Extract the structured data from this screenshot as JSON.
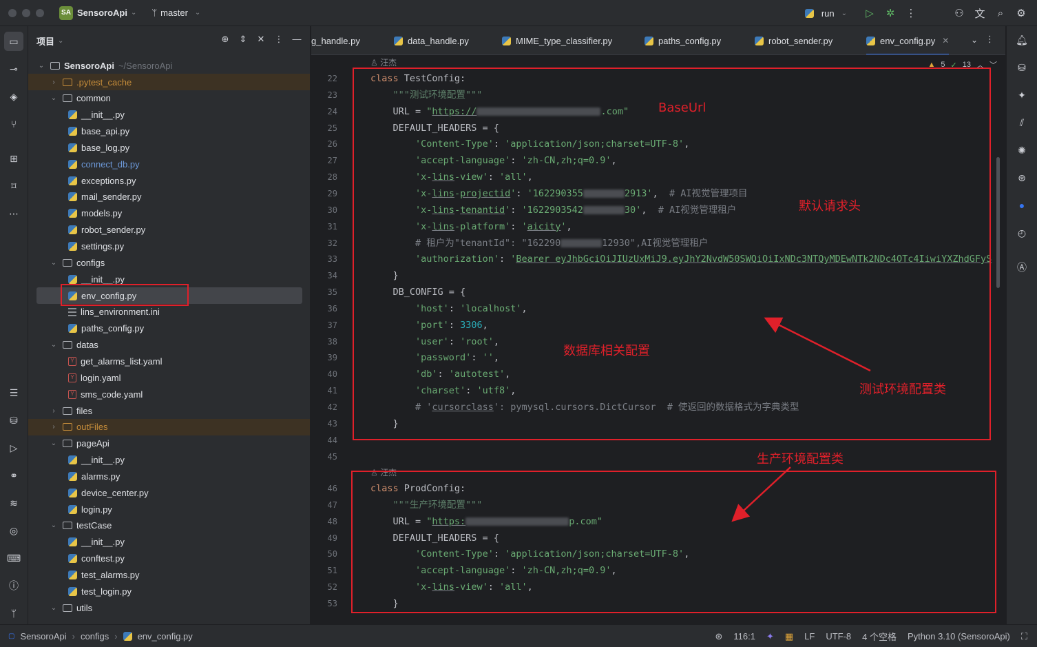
{
  "titlebar": {
    "project_badge": "SA",
    "project_name": "SensoroApi",
    "branch": "master",
    "run_config": "run"
  },
  "project_panel": {
    "title": "项目",
    "root_name": "SensoroApi",
    "root_path": "~/SensoroApi",
    "items": [
      {
        "label": ".pytest_cache",
        "kind": "folder",
        "depth": 1,
        "expanded": false,
        "excluded": true
      },
      {
        "label": "common",
        "kind": "folder",
        "depth": 1,
        "expanded": true
      },
      {
        "label": "__init__.py",
        "kind": "py",
        "depth": 2
      },
      {
        "label": "base_api.py",
        "kind": "py",
        "depth": 2
      },
      {
        "label": "base_log.py",
        "kind": "py",
        "depth": 2
      },
      {
        "label": "connect_db.py",
        "kind": "py",
        "depth": 2,
        "link": true
      },
      {
        "label": "exceptions.py",
        "kind": "py",
        "depth": 2
      },
      {
        "label": "mail_sender.py",
        "kind": "py",
        "depth": 2
      },
      {
        "label": "models.py",
        "kind": "py",
        "depth": 2
      },
      {
        "label": "robot_sender.py",
        "kind": "py",
        "depth": 2
      },
      {
        "label": "settings.py",
        "kind": "py",
        "depth": 2
      },
      {
        "label": "configs",
        "kind": "folder",
        "depth": 1,
        "expanded": true
      },
      {
        "label": "__init__.py",
        "kind": "py",
        "depth": 2
      },
      {
        "label": "env_config.py",
        "kind": "py",
        "depth": 2,
        "selected": true
      },
      {
        "label": "lins_environment.ini",
        "kind": "ini",
        "depth": 2
      },
      {
        "label": "paths_config.py",
        "kind": "py",
        "depth": 2
      },
      {
        "label": "datas",
        "kind": "folder",
        "depth": 1,
        "expanded": true
      },
      {
        "label": "get_alarms_list.yaml",
        "kind": "yaml",
        "depth": 2
      },
      {
        "label": "login.yaml",
        "kind": "yaml",
        "depth": 2
      },
      {
        "label": "sms_code.yaml",
        "kind": "yaml",
        "depth": 2
      },
      {
        "label": "files",
        "kind": "folder",
        "depth": 1,
        "expanded": false
      },
      {
        "label": "outFiles",
        "kind": "folder",
        "depth": 1,
        "expanded": false,
        "excluded": true
      },
      {
        "label": "pageApi",
        "kind": "folder",
        "depth": 1,
        "expanded": true
      },
      {
        "label": "__init__.py",
        "kind": "py",
        "depth": 2
      },
      {
        "label": "alarms.py",
        "kind": "py",
        "depth": 2
      },
      {
        "label": "device_center.py",
        "kind": "py",
        "depth": 2
      },
      {
        "label": "login.py",
        "kind": "py",
        "depth": 2
      },
      {
        "label": "testCase",
        "kind": "folder",
        "depth": 1,
        "expanded": true
      },
      {
        "label": "__init__.py",
        "kind": "py",
        "depth": 2
      },
      {
        "label": "conftest.py",
        "kind": "py",
        "depth": 2
      },
      {
        "label": "test_alarms.py",
        "kind": "py",
        "depth": 2
      },
      {
        "label": "test_login.py",
        "kind": "py",
        "depth": 2
      },
      {
        "label": "utils",
        "kind": "folder",
        "depth": 1,
        "expanded": true
      }
    ]
  },
  "tabs": [
    {
      "label": "g_handle.py"
    },
    {
      "label": "data_handle.py"
    },
    {
      "label": "MIME_type_classifier.py"
    },
    {
      "label": "paths_config.py"
    },
    {
      "label": "robot_sender.py"
    },
    {
      "label": "env_config.py",
      "active": true
    }
  ],
  "inspections": {
    "warnings": "5",
    "ok": "13"
  },
  "editor": {
    "author_1": "汪杰",
    "author_2": "汪杰",
    "lines": [
      {
        "n": "22",
        "html": "<span class='kw'>class</span> TestConfig:"
      },
      {
        "n": "23",
        "html": "    <span class='docs'>\"\"\"测试环境配置\"\"\"</span>"
      },
      {
        "n": "24",
        "html": "    URL = <span class='str'>\"<span class='ul'>https://</span><span class='blur' style='width:180px'></span>.com\"</span>"
      },
      {
        "n": "25",
        "html": "    DEFAULT_HEADERS = {"
      },
      {
        "n": "26",
        "html": "        <span class='str'>'Content-Type'</span>: <span class='str'>'application/json;charset=UTF-8'</span>,"
      },
      {
        "n": "27",
        "html": "        <span class='str'>'accept-language'</span>: <span class='str'>'zh-CN,zh;q=0.9'</span>,"
      },
      {
        "n": "28",
        "html": "        <span class='str'>'x-<span class='ul'>lins</span>-view'</span>: <span class='str'>'all'</span>,"
      },
      {
        "n": "29",
        "html": "        <span class='str'>'x-<span class='ul'>lins</span>-<span class='ul'>projectid</span>'</span>: <span class='str'>'162290355<span class='blur'></span>2913'</span>,  <span class='cmt'># AI视觉管理项目</span>"
      },
      {
        "n": "30",
        "html": "        <span class='str'>'x-<span class='ul'>lins</span>-<span class='ul'>tenantid</span>'</span>: <span class='str'>'1622903542<span class='blur'></span>30'</span>,  <span class='cmt'># AI视觉管理租户</span>"
      },
      {
        "n": "31",
        "html": "        <span class='str'>'x-<span class='ul'>lins</span>-platform'</span>: <span class='str'>'<span class='ul'>aicity</span>'</span>,"
      },
      {
        "n": "32",
        "html": "        <span class='cmt'># 租户为\"tenantId\": \"162290<span class='blur'></span>12930\",AI视觉管理租户</span>"
      },
      {
        "n": "33",
        "html": "        <span class='str'>'authorization'</span>: <span class='str'>'<span class='ul'>Bearer eyJhbGciOiJIUzUxMiJ9.eyJhY2NvdW50SWQiOiIxNDc3NTQyMDEwNTk2NDc4OTc4IiwiYXZhdGFyS</span></span>"
      },
      {
        "n": "34",
        "html": "    }"
      },
      {
        "n": "35",
        "html": "    DB_CONFIG = {"
      },
      {
        "n": "36",
        "html": "        <span class='str'>'host'</span>: <span class='str'>'localhost'</span>,"
      },
      {
        "n": "37",
        "html": "        <span class='str'>'port'</span>: <span class='num'>3306</span>,"
      },
      {
        "n": "38",
        "html": "        <span class='str'>'user'</span>: <span class='str'>'root'</span>,"
      },
      {
        "n": "39",
        "html": "        <span class='str'>'password'</span>: <span class='str'>''</span>,"
      },
      {
        "n": "40",
        "html": "        <span class='str'>'db'</span>: <span class='str'>'autotest'</span>,"
      },
      {
        "n": "41",
        "html": "        <span class='str'>'charset'</span>: <span class='str'>'utf8'</span>,"
      },
      {
        "n": "42",
        "html": "        <span class='cmt'># '<span class='ul'>cursorclass</span>': pymysql.cursors.DictCursor  # 使返回的数据格式为字典类型</span>"
      },
      {
        "n": "43",
        "html": "    }"
      },
      {
        "n": "44",
        "html": ""
      },
      {
        "n": "45",
        "html": ""
      },
      {
        "n": "46",
        "html": "<span class='kw'>class</span> ProdConfig:"
      },
      {
        "n": "47",
        "html": "    <span class='docs'>\"\"\"生产环境配置\"\"\"</span>"
      },
      {
        "n": "48",
        "html": "    URL = <span class='str'>\"<span class='ul'>https:</span><span class='blur' style='width:150px'></span>p.com\"</span>"
      },
      {
        "n": "49",
        "html": "    DEFAULT_HEADERS = {"
      },
      {
        "n": "50",
        "html": "        <span class='str'>'Content-Type'</span>: <span class='str'>'application/json;charset=UTF-8'</span>,"
      },
      {
        "n": "51",
        "html": "        <span class='str'>'accept-language'</span>: <span class='str'>'zh-CN,zh;q=0.9'</span>,"
      },
      {
        "n": "52",
        "html": "        <span class='str'>'x-<span class='ul'>lins</span>-view'</span>: <span class='str'>'all'</span>,"
      },
      {
        "n": "53",
        "html": "    }"
      }
    ]
  },
  "annotations": {
    "baseurl": "BaseUrl",
    "default_headers": "默认请求头",
    "db_config": "数据库相关配置",
    "test_config_class": "测试环境配置类",
    "prod_config_class": "生产环境配置类",
    "color": "#e0202a"
  },
  "statusbar": {
    "crumb_project": "SensoroApi",
    "crumb_folder": "configs",
    "crumb_file": "env_config.py",
    "position": "116:1",
    "line_sep": "LF",
    "encoding": "UTF-8",
    "indent": "4 个空格",
    "interpreter": "Python 3.10 (SensoroApi)"
  }
}
